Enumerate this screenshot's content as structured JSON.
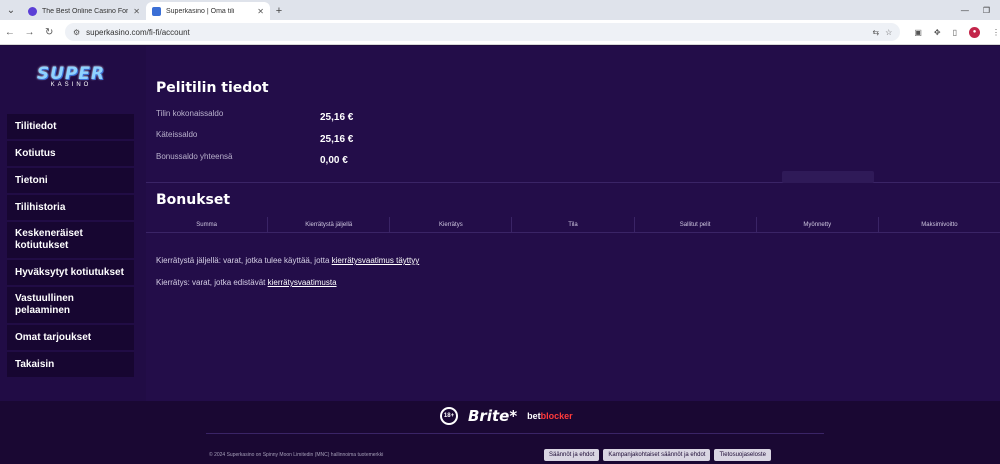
{
  "browser": {
    "tabs": [
      {
        "title": "The Best Online Casino Forum",
        "active": false
      },
      {
        "title": "Superkasino | Oma tili",
        "active": true
      }
    ],
    "url": "superkasino.com/fi-fi/account"
  },
  "logo": {
    "top": "SUPER",
    "bottom": "KASINO"
  },
  "sidebar": {
    "items": [
      {
        "label": "Tilitiedot"
      },
      {
        "label": "Kotiutus"
      },
      {
        "label": "Tietoni"
      },
      {
        "label": "Tilihistoria"
      },
      {
        "label": "Keskeneräiset kotiutukset"
      },
      {
        "label": "Hyväksytyt kotiutukset"
      },
      {
        "label": "Vastuullinen pelaaminen"
      },
      {
        "label": "Omat tarjoukset"
      },
      {
        "label": "Takaisin"
      }
    ]
  },
  "account": {
    "title": "Pelitilin tiedot",
    "rows": [
      {
        "label": "Tilin kokonaissaldo",
        "value": "25,16 €"
      },
      {
        "label": "Käteissaldo",
        "value": "25,16 €"
      },
      {
        "label": "Bonussaldo yhteensä",
        "value": "0,00 €"
      }
    ]
  },
  "bonus": {
    "title": "Bonukset",
    "columns": [
      "Summa",
      "Kierrätystä jäljellä",
      "Kierrätys",
      "Tila",
      "Sallitut pelit",
      "Myönnetty",
      "Maksimivoitto"
    ],
    "note1_text": "Kierrätystä jäljellä: varat, jotka tulee käyttää, jotta ",
    "note1_link": "kierrätysvaatimus täyttyy",
    "note2_text": "Kierrätys: varat, jotka edistävät ",
    "note2_link": "kierrätysvaatimusta"
  },
  "footer": {
    "age_badge": "18+",
    "brite": "Brite*",
    "betblocker_a": "bet",
    "betblocker_b": "blocker",
    "copyright": "© 2024 Superkasino on Spinny Moon Limitedin (MNC) hallinnoima tuotemerkki",
    "links": [
      "Säännöt ja ehdot",
      "Kampanjakohtaiset säännöt ja ehdot",
      "Tietosuojaseloste"
    ]
  }
}
